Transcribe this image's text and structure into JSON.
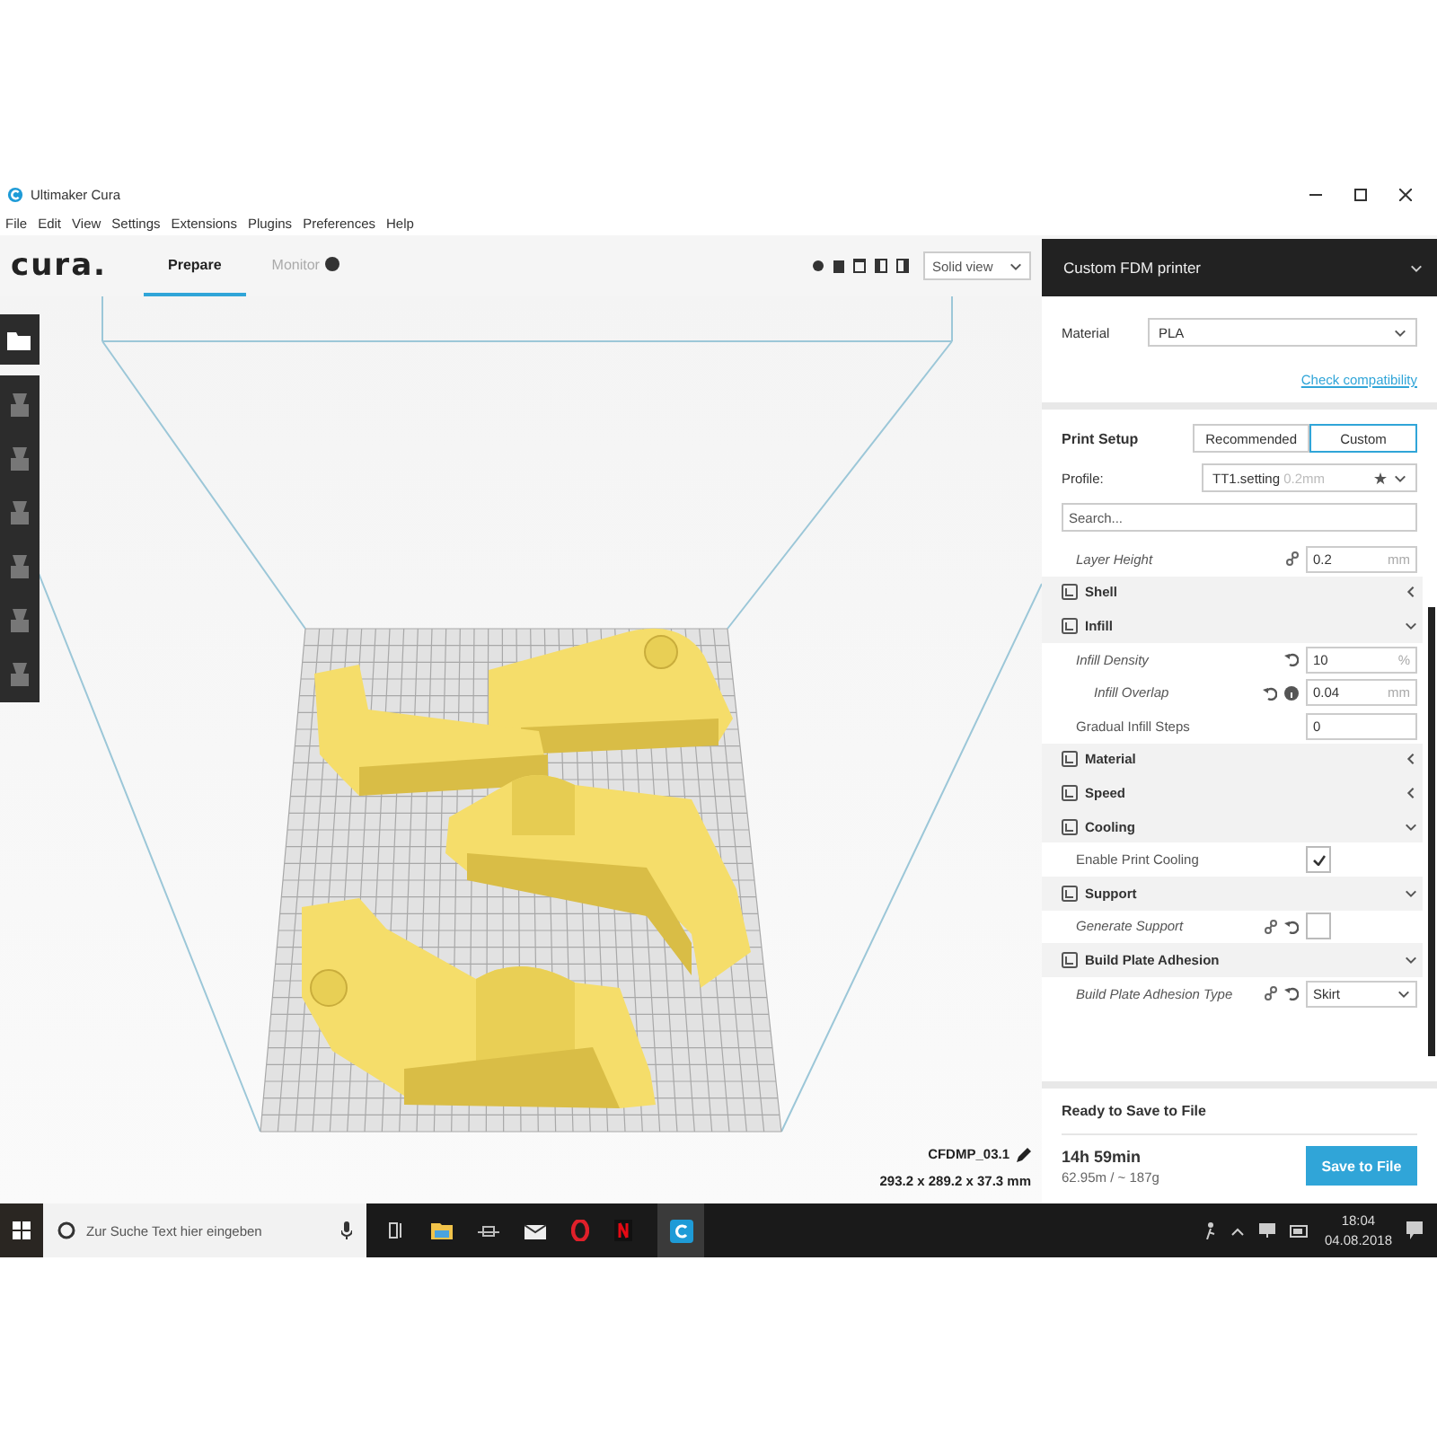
{
  "window": {
    "title": "Ultimaker Cura",
    "menu": [
      "File",
      "Edit",
      "View",
      "Settings",
      "Extensions",
      "Plugins",
      "Preferences",
      "Help"
    ]
  },
  "header": {
    "logo": "cura.",
    "tabs": [
      {
        "label": "Prepare",
        "selected": true
      },
      {
        "label": "Monitor",
        "selected": false
      }
    ],
    "view_mode": "Solid view",
    "printer": "Custom FDM printer"
  },
  "viewport": {
    "object_name": "CFDMP_03.1",
    "dimensions": "293.2 x 289.2 x 37.3 mm"
  },
  "panel": {
    "material": {
      "label": "Material",
      "value": "PLA"
    },
    "check_link": "Check compatibility",
    "print_setup": {
      "title": "Print Setup",
      "modes": [
        {
          "label": "Recommended",
          "selected": false
        },
        {
          "label": "Custom",
          "selected": true
        }
      ]
    },
    "profile": {
      "label": "Profile:",
      "value": "TT1.setting",
      "hint": "0.2mm"
    },
    "search": {
      "placeholder": "Search..."
    },
    "settings": [
      {
        "kind": "value",
        "label": "Layer Height",
        "value": "0.2",
        "unit": "mm",
        "modified": true,
        "linked": true,
        "resettable": false
      },
      {
        "kind": "category",
        "label": "Shell",
        "expanded": false
      },
      {
        "kind": "category",
        "label": "Infill",
        "expanded": true,
        "children": [
          {
            "kind": "value",
            "label": "Infill Density",
            "value": "10",
            "unit": "%",
            "modified": true,
            "linked": false,
            "resettable": true,
            "children": [
              {
                "kind": "value",
                "label": "Infill Overlap",
                "value": "0.04",
                "unit": "mm",
                "modified": true,
                "linked": false,
                "resettable": true,
                "info": true
              }
            ]
          },
          {
            "kind": "value",
            "label": "Gradual Infill Steps",
            "value": "0",
            "modified": false,
            "linked": false,
            "resettable": false
          }
        ]
      },
      {
        "kind": "category",
        "label": "Material",
        "expanded": false
      },
      {
        "kind": "category",
        "label": "Speed",
        "expanded": false
      },
      {
        "kind": "category",
        "label": "Cooling",
        "expanded": true,
        "children": [
          {
            "kind": "checkbox",
            "label": "Enable Print Cooling",
            "checked": true,
            "modified": false,
            "linked": false,
            "resettable": false
          }
        ]
      },
      {
        "kind": "category",
        "label": "Support",
        "expanded": true,
        "children": [
          {
            "kind": "checkbox",
            "label": "Generate Support",
            "checked": false,
            "modified": true,
            "linked": true,
            "resettable": true
          }
        ]
      },
      {
        "kind": "category",
        "label": "Build Plate Adhesion",
        "expanded": true,
        "children": [
          {
            "kind": "dropdown",
            "label": "Build Plate Adhesion Type",
            "value": "Skirt",
            "modified": true,
            "linked": true,
            "resettable": true
          }
        ]
      }
    ],
    "footer": {
      "status": "Ready to Save to File",
      "time": "14h 59min",
      "usage": "62.95m / ~ 187g",
      "button": "Save to File"
    }
  },
  "taskbar": {
    "search_placeholder": "Zur Suche Text hier eingeben",
    "time": "18:04",
    "date": "04.08.2018"
  }
}
